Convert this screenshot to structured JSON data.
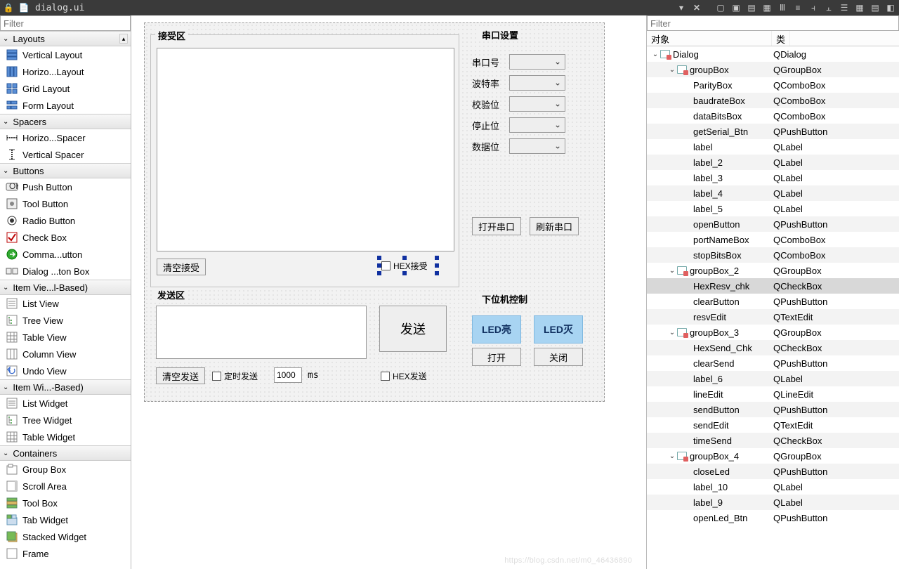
{
  "titlebar": {
    "title": "dialog.ui"
  },
  "filters": {
    "placeholder": "Filter"
  },
  "objtree": {
    "headers": {
      "object": "对象",
      "class": "类"
    },
    "rows": [
      {
        "d": 0,
        "c": true,
        "i": true,
        "n": "Dialog",
        "k": "QDialog"
      },
      {
        "d": 1,
        "c": true,
        "i": true,
        "n": "groupBox",
        "k": "QGroupBox"
      },
      {
        "d": 2,
        "c": false,
        "i": false,
        "n": "ParityBox",
        "k": "QComboBox"
      },
      {
        "d": 2,
        "c": false,
        "i": false,
        "n": "baudrateBox",
        "k": "QComboBox"
      },
      {
        "d": 2,
        "c": false,
        "i": false,
        "n": "dataBitsBox",
        "k": "QComboBox"
      },
      {
        "d": 2,
        "c": false,
        "i": false,
        "n": "getSerial_Btn",
        "k": "QPushButton"
      },
      {
        "d": 2,
        "c": false,
        "i": false,
        "n": "label",
        "k": "QLabel"
      },
      {
        "d": 2,
        "c": false,
        "i": false,
        "n": "label_2",
        "k": "QLabel"
      },
      {
        "d": 2,
        "c": false,
        "i": false,
        "n": "label_3",
        "k": "QLabel"
      },
      {
        "d": 2,
        "c": false,
        "i": false,
        "n": "label_4",
        "k": "QLabel"
      },
      {
        "d": 2,
        "c": false,
        "i": false,
        "n": "label_5",
        "k": "QLabel"
      },
      {
        "d": 2,
        "c": false,
        "i": false,
        "n": "openButton",
        "k": "QPushButton"
      },
      {
        "d": 2,
        "c": false,
        "i": false,
        "n": "portNameBox",
        "k": "QComboBox"
      },
      {
        "d": 2,
        "c": false,
        "i": false,
        "n": "stopBitsBox",
        "k": "QComboBox"
      },
      {
        "d": 1,
        "c": true,
        "i": true,
        "n": "groupBox_2",
        "k": "QGroupBox"
      },
      {
        "d": 2,
        "c": false,
        "i": false,
        "n": "HexResv_chk",
        "k": "QCheckBox",
        "sel": true
      },
      {
        "d": 2,
        "c": false,
        "i": false,
        "n": "clearButton",
        "k": "QPushButton"
      },
      {
        "d": 2,
        "c": false,
        "i": false,
        "n": "resvEdit",
        "k": "QTextEdit"
      },
      {
        "d": 1,
        "c": true,
        "i": true,
        "n": "groupBox_3",
        "k": "QGroupBox"
      },
      {
        "d": 2,
        "c": false,
        "i": false,
        "n": "HexSend_Chk",
        "k": "QCheckBox"
      },
      {
        "d": 2,
        "c": false,
        "i": false,
        "n": "clearSend",
        "k": "QPushButton"
      },
      {
        "d": 2,
        "c": false,
        "i": false,
        "n": "label_6",
        "k": "QLabel"
      },
      {
        "d": 2,
        "c": false,
        "i": false,
        "n": "lineEdit",
        "k": "QLineEdit"
      },
      {
        "d": 2,
        "c": false,
        "i": false,
        "n": "sendButton",
        "k": "QPushButton"
      },
      {
        "d": 2,
        "c": false,
        "i": false,
        "n": "sendEdit",
        "k": "QTextEdit"
      },
      {
        "d": 2,
        "c": false,
        "i": false,
        "n": "timeSend",
        "k": "QCheckBox"
      },
      {
        "d": 1,
        "c": true,
        "i": true,
        "n": "groupBox_4",
        "k": "QGroupBox"
      },
      {
        "d": 2,
        "c": false,
        "i": false,
        "n": "closeLed",
        "k": "QPushButton"
      },
      {
        "d": 2,
        "c": false,
        "i": false,
        "n": "label_10",
        "k": "QLabel"
      },
      {
        "d": 2,
        "c": false,
        "i": false,
        "n": "label_9",
        "k": "QLabel"
      },
      {
        "d": 2,
        "c": false,
        "i": false,
        "n": "openLed_Btn",
        "k": "QPushButton"
      }
    ]
  },
  "form": {
    "recv": {
      "title": "接受区",
      "clear": "清空接受",
      "hex": "HEX接受"
    },
    "send": {
      "title": "发送区",
      "clear": "清空发送",
      "timer": "定时发送",
      "ms_value": "1000",
      "ms_label": "ms",
      "hex": "HEX发送",
      "sendbtn": "发送"
    },
    "serial": {
      "title": "串口设置",
      "port": "串口号",
      "baud": "波特率",
      "parity": "校验位",
      "stop": "停止位",
      "data": "数据位",
      "open": "打开串口",
      "refresh": "刷新串口"
    },
    "lower": {
      "title": "下位机控制",
      "led_on": "LED亮",
      "led_off": "LED灭",
      "open": "打开",
      "close": "关闭"
    }
  },
  "widgetbox": {
    "sections": [
      {
        "title": "Layouts",
        "scrl": true,
        "items": [
          {
            "label": "Vertical Layout",
            "icon": "vlayout"
          },
          {
            "label": "Horizo...Layout",
            "icon": "hlayout"
          },
          {
            "label": "Grid Layout",
            "icon": "grid"
          },
          {
            "label": "Form Layout",
            "icon": "form"
          }
        ]
      },
      {
        "title": "Spacers",
        "items": [
          {
            "label": "Horizo...Spacer",
            "icon": "hspacer"
          },
          {
            "label": "Vertical Spacer",
            "icon": "vspacer"
          }
        ]
      },
      {
        "title": "Buttons",
        "items": [
          {
            "label": "Push Button",
            "icon": "pushbtn"
          },
          {
            "label": "Tool Button",
            "icon": "toolbtn"
          },
          {
            "label": "Radio Button",
            "icon": "radio"
          },
          {
            "label": "Check Box",
            "icon": "check"
          },
          {
            "label": "Comma...utton",
            "icon": "cmdlink"
          },
          {
            "label": "Dialog ...ton Box",
            "icon": "dlgbtn"
          }
        ]
      },
      {
        "title": "Item Vie...l-Based)",
        "items": [
          {
            "label": "List View",
            "icon": "listv"
          },
          {
            "label": "Tree View",
            "icon": "treev"
          },
          {
            "label": "Table View",
            "icon": "tablev"
          },
          {
            "label": "Column View",
            "icon": "colv"
          },
          {
            "label": "Undo View",
            "icon": "undov"
          }
        ]
      },
      {
        "title": "Item Wi...-Based)",
        "items": [
          {
            "label": "List Widget",
            "icon": "listv"
          },
          {
            "label": "Tree Widget",
            "icon": "treev"
          },
          {
            "label": "Table Widget",
            "icon": "tablev"
          }
        ]
      },
      {
        "title": "Containers",
        "items": [
          {
            "label": "Group Box",
            "icon": "groupbox"
          },
          {
            "label": "Scroll Area",
            "icon": "scroll"
          },
          {
            "label": "Tool Box",
            "icon": "toolbox"
          },
          {
            "label": "Tab Widget",
            "icon": "tab"
          },
          {
            "label": "Stacked Widget",
            "icon": "stack"
          },
          {
            "label": "Frame",
            "icon": "frame"
          }
        ]
      }
    ]
  },
  "watermark": "https://blog.csdn.net/m0_46436890"
}
